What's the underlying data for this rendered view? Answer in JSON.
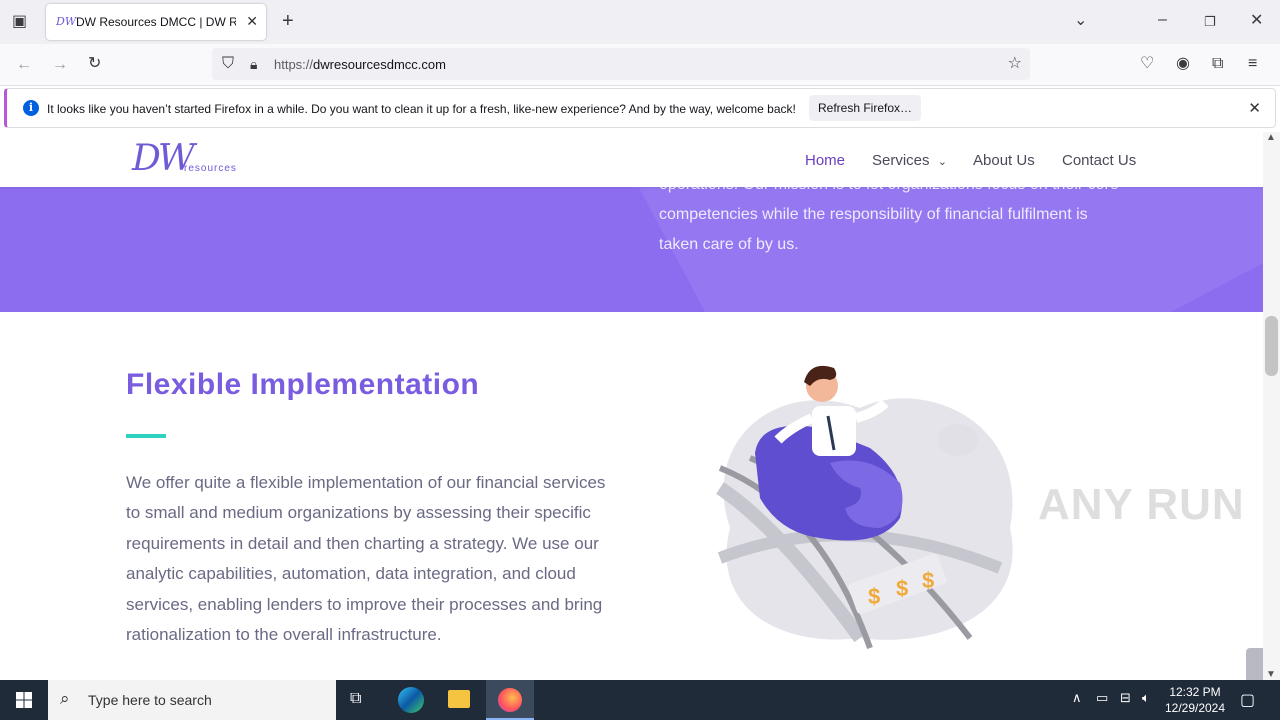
{
  "browser": {
    "tab_title": "DW Resources DMCC | DW Resources",
    "tab_favicon": "DW",
    "url_prefix": "https://",
    "url_domain": "dwresourcesdmcc.com",
    "notification": {
      "message": "It looks like you haven’t started Firefox in a while. Do you want to clean it up for a fresh, like-new experience? And by the way, welcome back!",
      "button": "Refresh Firefox…"
    }
  },
  "site": {
    "logo_main": "DW",
    "logo_sub": "resources",
    "nav": [
      {
        "label": "Home"
      },
      {
        "label": "Services"
      },
      {
        "label": "About Us"
      },
      {
        "label": "Contact Us"
      }
    ],
    "hero_text": "operations. Our mission is to let organizations focus on their core competencies while the responsibility of financial fulfilment is taken care of by us.",
    "section": {
      "title": "Flexible Implementation",
      "body": "We offer quite a flexible implementation of our financial services to small and medium organizations by assessing their specific requirements in detail and then charting a strategy. We use our analytic capabilities, automation, data integration, and cloud services, enabling lenders to improve their processes and bring rationalization to the overall infrastructure."
    },
    "colors": {
      "accent": "#7a5ce0",
      "hero_bg": "#8c6df0",
      "divider": "#2fd2c0"
    }
  },
  "watermark": "ANY RUN",
  "taskbar": {
    "search_placeholder": "Type here to search",
    "time": "12:32 PM",
    "date": "12/29/2024"
  }
}
